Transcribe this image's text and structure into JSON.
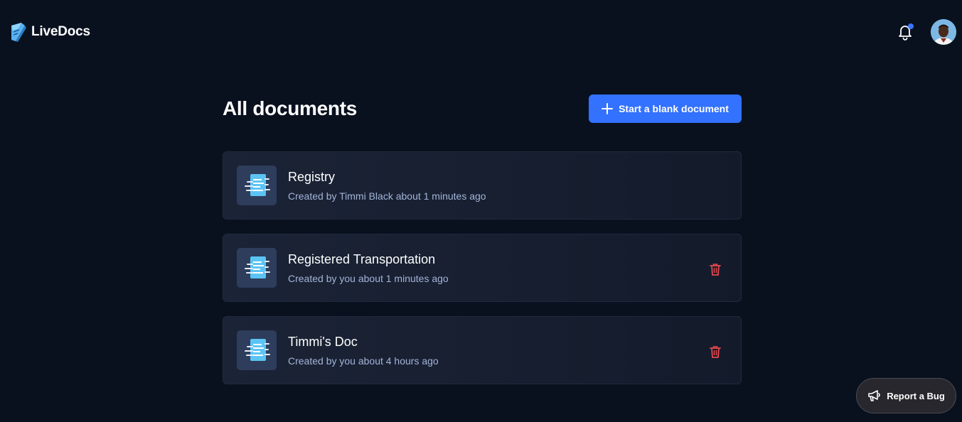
{
  "app": {
    "name": "LiveDocs",
    "accent_color": "#3371ff"
  },
  "header": {
    "notification_icon": "bell-icon",
    "has_unread_notifications": true,
    "avatar_icon": "user-avatar"
  },
  "main": {
    "title": "All documents",
    "new_document_label": "Start a blank document"
  },
  "documents": [
    {
      "title": "Registry",
      "meta": "Created by Timmi Black about 1 minutes ago",
      "deletable": false
    },
    {
      "title": "Registered Transportation",
      "meta": "Created by you about 1 minutes ago",
      "deletable": true
    },
    {
      "title": "Timmi's Doc",
      "meta": "Created by you about 4 hours ago",
      "deletable": true
    }
  ],
  "report_bug": {
    "label": "Report a Bug",
    "icon": "megaphone-icon"
  }
}
